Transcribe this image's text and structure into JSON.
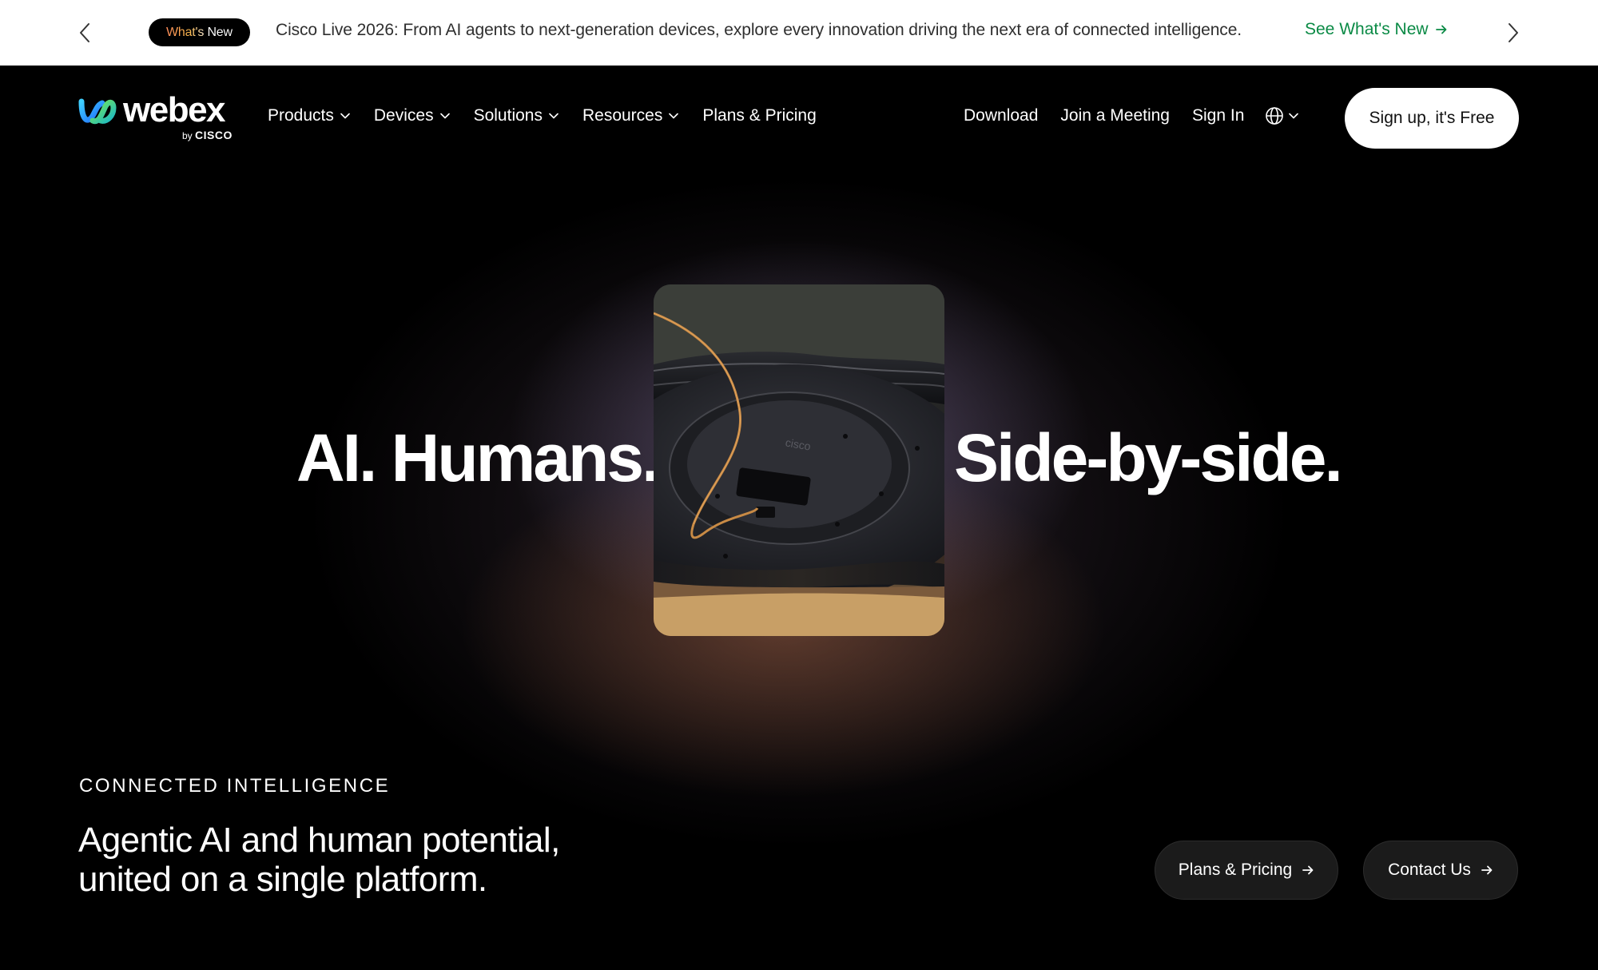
{
  "announcement": {
    "badge": "What's New",
    "message": "Cisco Live 2026: From AI agents to next-generation devices, explore every innovation driving the next era of connected intelligence.",
    "link_label": "See What's New",
    "prev_icon": "chevron-left-icon",
    "next_icon": "chevron-right-icon",
    "link_color": "#0a8a45"
  },
  "logo": {
    "wordmark": "webex",
    "by_prefix": "by",
    "by_brand": "CISCO"
  },
  "nav": {
    "items": [
      {
        "label": "Products",
        "has_dropdown": true
      },
      {
        "label": "Devices",
        "has_dropdown": true
      },
      {
        "label": "Solutions",
        "has_dropdown": true
      },
      {
        "label": "Resources",
        "has_dropdown": true
      },
      {
        "label": "Plans & Pricing",
        "has_dropdown": false
      }
    ],
    "right_links": [
      {
        "label": "Download"
      },
      {
        "label": "Join a Meeting"
      },
      {
        "label": "Sign In"
      }
    ],
    "language_icon": "globe-icon",
    "signup_label": "Sign up, it's Free"
  },
  "hero": {
    "headline_left": "AI. Humans.",
    "headline_right": "Side-by-side.",
    "eyebrow": "CONNECTED INTELLIGENCE",
    "subheading": "Agentic AI and human potential, united on a single platform.",
    "cta_primary": "Plans & Pricing",
    "cta_secondary": "Contact Us",
    "product_brand_mark": "cisco"
  }
}
